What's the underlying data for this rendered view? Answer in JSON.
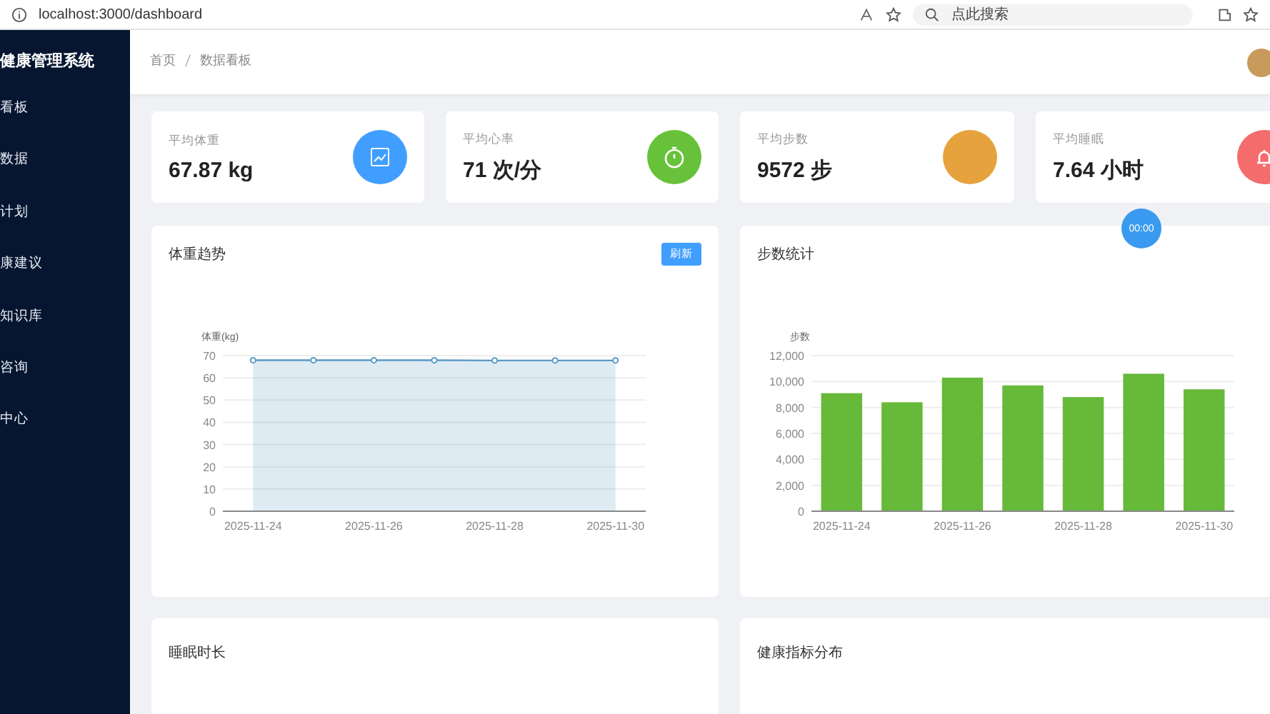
{
  "browser": {
    "url": "localhost:3000/dashboard",
    "search_placeholder": "点此搜索"
  },
  "sidebar": {
    "title": "健康管理系统",
    "items": [
      {
        "label": "看板"
      },
      {
        "label": "数据"
      },
      {
        "label": "计划"
      },
      {
        "label": "康建议"
      },
      {
        "label": "知识库"
      },
      {
        "label": "咨询"
      },
      {
        "label": "中心"
      }
    ]
  },
  "header": {
    "breadcrumb": [
      "首页",
      "数据看板"
    ]
  },
  "stats": [
    {
      "label": "平均体重",
      "value": "67.87 kg",
      "color": "#409eff"
    },
    {
      "label": "平均心率",
      "value": "71 次/分",
      "color": "#67c23a"
    },
    {
      "label": "平均步数",
      "value": "9572 步",
      "color": "#e6a23c"
    },
    {
      "label": "平均睡眠",
      "value": "7.64 小时",
      "color": "#f56c6c"
    }
  ],
  "weight_card": {
    "title": "体重趋势",
    "button": "刷新",
    "chart_data": {
      "type": "area",
      "ylabel": "体重(kg)",
      "grid": true,
      "categories": [
        "2025-11-24",
        null,
        "2025-11-26",
        null,
        "2025-11-28",
        null,
        "2025-11-30"
      ],
      "series": [
        {
          "color": "#5b9bc4",
          "marker": true,
          "values": [
            67.9,
            67.9,
            67.9,
            67.9,
            67.8,
            67.8,
            67.8
          ]
        }
      ],
      "ylim": [
        0,
        70
      ],
      "yticks": [
        0,
        10,
        20,
        30,
        40,
        50,
        60,
        70
      ]
    }
  },
  "steps_card": {
    "title": "步数统计",
    "chart_data": {
      "type": "bar",
      "ylabel": "步数",
      "grid": true,
      "categories": [
        "2025-11-24",
        null,
        "2025-11-26",
        null,
        "2025-11-28",
        null,
        "2025-11-30"
      ],
      "series": [
        {
          "color": "#67b93a",
          "values": [
            9100,
            8400,
            10300,
            9700,
            8800,
            10600,
            9400
          ]
        }
      ],
      "ylim": [
        0,
        12000
      ],
      "yticks": [
        {
          "value": 0,
          "label": "0"
        },
        {
          "value": 2000,
          "label": "2,000"
        },
        {
          "value": 4000,
          "label": "4,000"
        },
        {
          "value": 6000,
          "label": "6,000"
        },
        {
          "value": 8000,
          "label": "8,000"
        },
        {
          "value": 10000,
          "label": "10,000"
        },
        {
          "value": 12000,
          "label": "12,000"
        }
      ]
    }
  },
  "bottom_cards": [
    {
      "title": "睡眠时长"
    },
    {
      "title": "健康指标分布"
    }
  ],
  "floating_badge": "00:00"
}
